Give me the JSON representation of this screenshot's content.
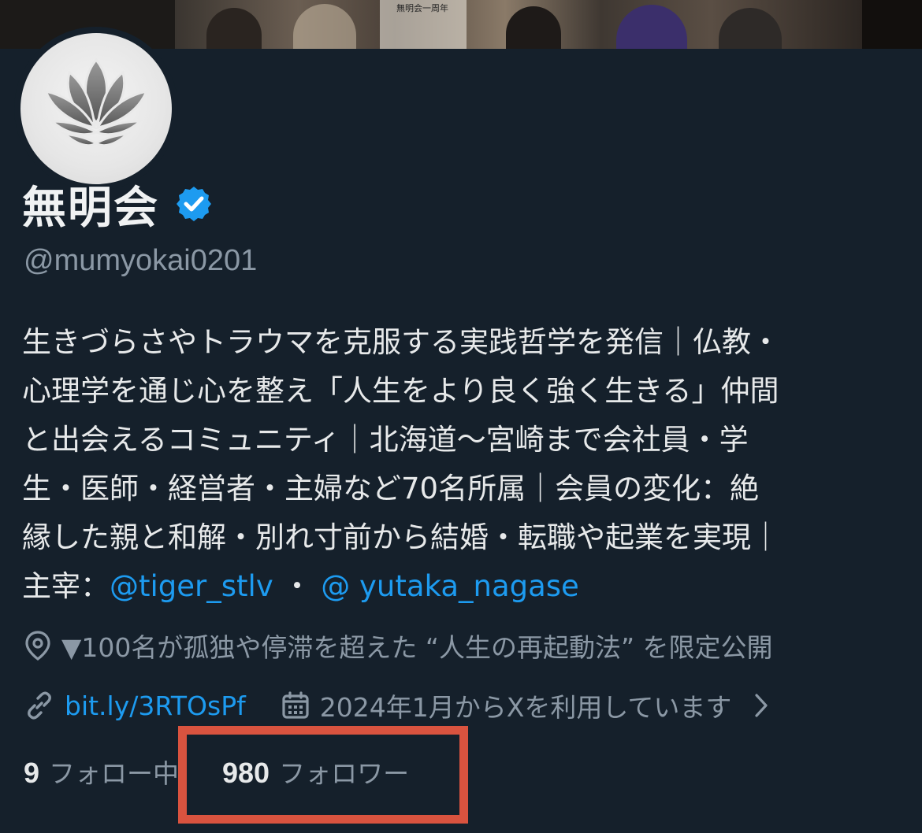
{
  "banner": {
    "sign_text": "無明会一周年"
  },
  "profile": {
    "name": "無明会",
    "handle": "@mumyokai0201",
    "bio_lines": [
      "生きづらさやトラウマを克服する実践哲学を発信｜仏教・",
      "心理学を通じ心を整え「人生をより良く強く生きる」仲間",
      "と出会えるコミュニティ｜北海道〜宮崎まで会社員・学",
      "生・医師・経営者・主婦など70名所属｜会員の変化：絶",
      "縁した親と和解・別れ寸前から結婚・転職や起業を実現｜"
    ],
    "bio_last_prefix": "主宰：",
    "mention_1": "@tiger_stlv",
    "bio_separator": " ・ ",
    "mention_2": "@ yutaka_nagase",
    "location": "▼100名が孤独や停滞を超えた “人生の再起動法” を限定公開",
    "url": "bit.ly/3RTOsPf",
    "joined": "2024年1月からXを利用しています",
    "following_count": "9",
    "following_label": "フォロー中",
    "followers_count": "980",
    "followers_label": "フォロワー"
  },
  "icons": {
    "verified": "verified-badge-icon",
    "location": "location-pin-icon",
    "link": "link-icon",
    "calendar": "calendar-icon",
    "chevron": "chevron-right-icon",
    "avatar": "lotus-icon"
  },
  "colors": {
    "background": "#15202b",
    "accent": "#1d9bf0",
    "muted": "#8b98a5",
    "highlight": "#d9533f"
  }
}
